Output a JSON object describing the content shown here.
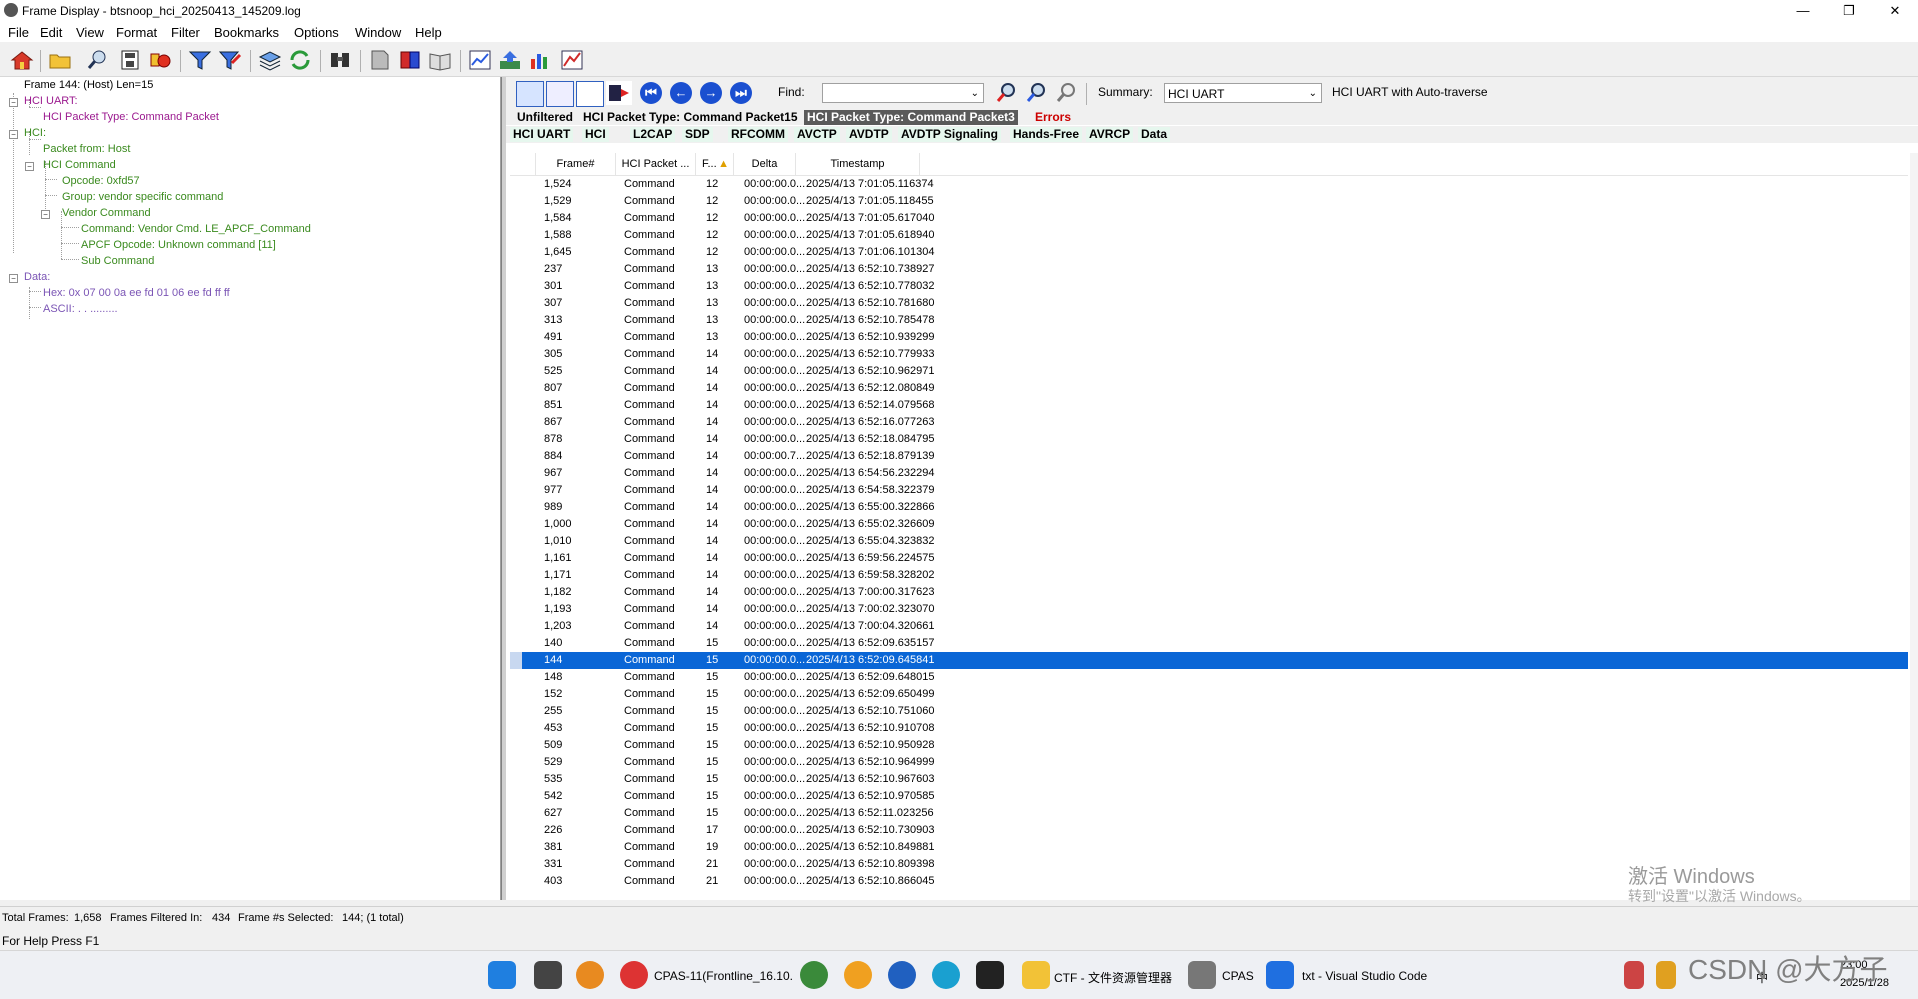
{
  "window": {
    "title": "Frame Display - btsnoop_hci_20250413_145209.log",
    "controls": [
      "—",
      "❐",
      "✕"
    ]
  },
  "menu": [
    "File",
    "Edit",
    "View",
    "Format",
    "Filter",
    "Bookmarks",
    "Options",
    "Window",
    "Help"
  ],
  "toolbar_icons": [
    "home-icon",
    "open-folder-icon",
    "search-icon",
    "save-icon",
    "stats-icon",
    "filter-icon",
    "filter-edit-icon",
    "layers-icon",
    "refresh-icon",
    "binoculars-icon",
    "page-icon",
    "book-icon",
    "open-book-icon",
    "chart-icon",
    "export-icon",
    "bar-chart-icon",
    "graph-icon"
  ],
  "tree": [
    {
      "text": "Frame 144: (Host) Len=15",
      "color": "#000000"
    },
    {
      "text": "HCI UART:",
      "color": "#9b1a8f"
    },
    {
      "text": "HCI Packet Type: Command Packet",
      "color": "#9b1a8f"
    },
    {
      "text": "HCI:",
      "color": "#3a8a1e"
    },
    {
      "text": "Packet from: Host",
      "color": "#3a8a1e"
    },
    {
      "text": "HCI Command",
      "color": "#3a8a1e"
    },
    {
      "text": "Opcode: 0xfd57",
      "color": "#3a8a1e"
    },
    {
      "text": "Group: vendor specific command",
      "color": "#3a8a1e"
    },
    {
      "text": "Vendor Command",
      "color": "#3a8a1e"
    },
    {
      "text": "Command: Vendor Cmd. LE_APCF_Command",
      "color": "#3a8a1e"
    },
    {
      "text": "APCF Opcode: Unknown command [11]",
      "color": "#3a8a1e"
    },
    {
      "text": "Sub Command",
      "color": "#3a8a1e"
    },
    {
      "text": "Data:",
      "color": "#7b55b5"
    },
    {
      "text": "Hex: 0x 07 00 0a ee fd 01 06 ee fd ff ff",
      "color": "#7b55b5"
    },
    {
      "text": "ASCII: . . .........",
      "color": "#7b55b5"
    }
  ],
  "nav": {
    "find_label": "Find:",
    "find_value": "",
    "summary_label": "Summary:",
    "summary_value": "HCI UART",
    "summary_note": "HCI UART with Auto-traverse"
  },
  "tabs_row1": [
    "Unfiltered",
    "HCI Packet Type: Command Packet15",
    "HCI Packet Type: Command Packet3",
    "Errors"
  ],
  "tabs_row2": [
    "HCI UART",
    "HCI",
    "L2CAP",
    "SDP",
    "RFCOMM",
    "AVCTP",
    "AVDTP",
    "AVDTP Signaling",
    "Hands-Free",
    "AVRCP",
    "Data"
  ],
  "columns": [
    "Frame#",
    "HCI Packet ...",
    "F...",
    "Delta",
    "Timestamp"
  ],
  "rows": [
    {
      "frame": "1,524",
      "type": "Command",
      "f": "12",
      "delta": "00:00:00.0...",
      "ts": "2025/4/13 7:01:05.116374"
    },
    {
      "frame": "1,529",
      "type": "Command",
      "f": "12",
      "delta": "00:00:00.0...",
      "ts": "2025/4/13 7:01:05.118455"
    },
    {
      "frame": "1,584",
      "type": "Command",
      "f": "12",
      "delta": "00:00:00.0...",
      "ts": "2025/4/13 7:01:05.617040"
    },
    {
      "frame": "1,588",
      "type": "Command",
      "f": "12",
      "delta": "00:00:00.0...",
      "ts": "2025/4/13 7:01:05.618940"
    },
    {
      "frame": "1,645",
      "type": "Command",
      "f": "12",
      "delta": "00:00:00.0...",
      "ts": "2025/4/13 7:01:06.101304"
    },
    {
      "frame": "237",
      "type": "Command",
      "f": "13",
      "delta": "00:00:00.0...",
      "ts": "2025/4/13 6:52:10.738927"
    },
    {
      "frame": "301",
      "type": "Command",
      "f": "13",
      "delta": "00:00:00.0...",
      "ts": "2025/4/13 6:52:10.778032"
    },
    {
      "frame": "307",
      "type": "Command",
      "f": "13",
      "delta": "00:00:00.0...",
      "ts": "2025/4/13 6:52:10.781680"
    },
    {
      "frame": "313",
      "type": "Command",
      "f": "13",
      "delta": "00:00:00.0...",
      "ts": "2025/4/13 6:52:10.785478"
    },
    {
      "frame": "491",
      "type": "Command",
      "f": "13",
      "delta": "00:00:00.0...",
      "ts": "2025/4/13 6:52:10.939299"
    },
    {
      "frame": "305",
      "type": "Command",
      "f": "14",
      "delta": "00:00:00.0...",
      "ts": "2025/4/13 6:52:10.779933"
    },
    {
      "frame": "525",
      "type": "Command",
      "f": "14",
      "delta": "00:00:00.0...",
      "ts": "2025/4/13 6:52:10.962971"
    },
    {
      "frame": "807",
      "type": "Command",
      "f": "14",
      "delta": "00:00:00.0...",
      "ts": "2025/4/13 6:52:12.080849"
    },
    {
      "frame": "851",
      "type": "Command",
      "f": "14",
      "delta": "00:00:00.0...",
      "ts": "2025/4/13 6:52:14.079568"
    },
    {
      "frame": "867",
      "type": "Command",
      "f": "14",
      "delta": "00:00:00.0...",
      "ts": "2025/4/13 6:52:16.077263"
    },
    {
      "frame": "878",
      "type": "Command",
      "f": "14",
      "delta": "00:00:00.0...",
      "ts": "2025/4/13 6:52:18.084795"
    },
    {
      "frame": "884",
      "type": "Command",
      "f": "14",
      "delta": "00:00:00.7...",
      "ts": "2025/4/13 6:52:18.879139"
    },
    {
      "frame": "967",
      "type": "Command",
      "f": "14",
      "delta": "00:00:00.0...",
      "ts": "2025/4/13 6:54:56.232294"
    },
    {
      "frame": "977",
      "type": "Command",
      "f": "14",
      "delta": "00:00:00.0...",
      "ts": "2025/4/13 6:54:58.322379"
    },
    {
      "frame": "989",
      "type": "Command",
      "f": "14",
      "delta": "00:00:00.0...",
      "ts": "2025/4/13 6:55:00.322866"
    },
    {
      "frame": "1,000",
      "type": "Command",
      "f": "14",
      "delta": "00:00:00.0...",
      "ts": "2025/4/13 6:55:02.326609"
    },
    {
      "frame": "1,010",
      "type": "Command",
      "f": "14",
      "delta": "00:00:00.0...",
      "ts": "2025/4/13 6:55:04.323832"
    },
    {
      "frame": "1,161",
      "type": "Command",
      "f": "14",
      "delta": "00:00:00.0...",
      "ts": "2025/4/13 6:59:56.224575"
    },
    {
      "frame": "1,171",
      "type": "Command",
      "f": "14",
      "delta": "00:00:00.0...",
      "ts": "2025/4/13 6:59:58.328202"
    },
    {
      "frame": "1,182",
      "type": "Command",
      "f": "14",
      "delta": "00:00:00.0...",
      "ts": "2025/4/13 7:00:00.317623"
    },
    {
      "frame": "1,193",
      "type": "Command",
      "f": "14",
      "delta": "00:00:00.0...",
      "ts": "2025/4/13 7:00:02.323070"
    },
    {
      "frame": "1,203",
      "type": "Command",
      "f": "14",
      "delta": "00:00:00.0...",
      "ts": "2025/4/13 7:00:04.320661"
    },
    {
      "frame": "140",
      "type": "Command",
      "f": "15",
      "delta": "00:00:00.0...",
      "ts": "2025/4/13 6:52:09.635157"
    },
    {
      "frame": "144",
      "type": "Command",
      "f": "15",
      "delta": "00:00:00.0...",
      "ts": "2025/4/13 6:52:09.645841",
      "selected": true
    },
    {
      "frame": "148",
      "type": "Command",
      "f": "15",
      "delta": "00:00:00.0...",
      "ts": "2025/4/13 6:52:09.648015"
    },
    {
      "frame": "152",
      "type": "Command",
      "f": "15",
      "delta": "00:00:00.0...",
      "ts": "2025/4/13 6:52:09.650499"
    },
    {
      "frame": "255",
      "type": "Command",
      "f": "15",
      "delta": "00:00:00.0...",
      "ts": "2025/4/13 6:52:10.751060"
    },
    {
      "frame": "453",
      "type": "Command",
      "f": "15",
      "delta": "00:00:00.0...",
      "ts": "2025/4/13 6:52:10.910708"
    },
    {
      "frame": "509",
      "type": "Command",
      "f": "15",
      "delta": "00:00:00.0...",
      "ts": "2025/4/13 6:52:10.950928"
    },
    {
      "frame": "529",
      "type": "Command",
      "f": "15",
      "delta": "00:00:00.0...",
      "ts": "2025/4/13 6:52:10.964999"
    },
    {
      "frame": "535",
      "type": "Command",
      "f": "15",
      "delta": "00:00:00.0...",
      "ts": "2025/4/13 6:52:10.967603"
    },
    {
      "frame": "542",
      "type": "Command",
      "f": "15",
      "delta": "00:00:00.0...",
      "ts": "2025/4/13 6:52:10.970585"
    },
    {
      "frame": "627",
      "type": "Command",
      "f": "15",
      "delta": "00:00:00.0...",
      "ts": "2025/4/13 6:52:11.023256"
    },
    {
      "frame": "226",
      "type": "Command",
      "f": "17",
      "delta": "00:00:00.0...",
      "ts": "2025/4/13 6:52:10.730903"
    },
    {
      "frame": "381",
      "type": "Command",
      "f": "19",
      "delta": "00:00:00.0...",
      "ts": "2025/4/13 6:52:10.849881"
    },
    {
      "frame": "331",
      "type": "Command",
      "f": "21",
      "delta": "00:00:00.0...",
      "ts": "2025/4/13 6:52:10.809398"
    },
    {
      "frame": "403",
      "type": "Command",
      "f": "21",
      "delta": "00:00:00.0...",
      "ts": "2025/4/13 6:52:10.866045"
    }
  ],
  "status": {
    "total_label": "Total Frames:",
    "total": "1,658",
    "filtered_label": "Frames Filtered In:",
    "filtered": "434",
    "selected_label": "Frame #s Selected:",
    "selected": "144; (1 total)",
    "help": "For Help Press F1"
  },
  "watermark": {
    "line1": "激活 Windows",
    "line2": "转到\"设置\"以激活 Windows。"
  },
  "csdn": "CSDN @大方子",
  "taskbar": {
    "apps": [
      {
        "label": "CPAS-11(Frontline_16.10."
      },
      {
        "label": "CTF - 文件资源管理器"
      },
      {
        "label": "CPAS"
      },
      {
        "label": "txt - Visual Studio Code"
      }
    ],
    "tray_ime": "中",
    "clock_time": "23:00",
    "clock_date": "2025/1/28"
  },
  "colors": {
    "selected_row": "#0a66d6",
    "tab_highlight": "#5a5a5a",
    "errors": "#cc0000",
    "tab2_bg": "#e6f7ee"
  }
}
